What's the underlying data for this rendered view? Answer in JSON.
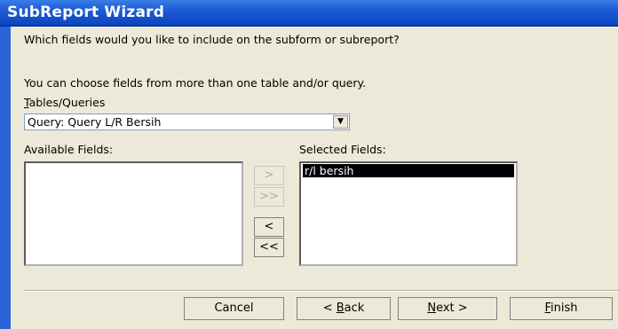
{
  "window": {
    "title": "SubReport Wizard"
  },
  "prompt": {
    "question": "Which fields would you like to include on the subform or subreport?",
    "hint": "You can choose fields from more than one table and/or query."
  },
  "tables_queries": {
    "label_accel": "T",
    "label_rest": "ables/Queries",
    "selected": "Query: Query L/R Bersih",
    "dropdown_icon": "chevron-down-icon"
  },
  "available_fields": {
    "label": "Available Fields:",
    "items": []
  },
  "selected_fields": {
    "label": "Selected Fields:",
    "items": [
      "r/l bersih"
    ]
  },
  "move_buttons": {
    "add_one": ">",
    "add_all": ">>",
    "remove_one": "<",
    "remove_all": "<<"
  },
  "buttons": {
    "cancel": "Cancel",
    "back_pre": "< ",
    "back_accel": "B",
    "back_rest": "ack",
    "next_accel": "N",
    "next_rest": "ext >",
    "finish_accel": "F",
    "finish_rest": "inish"
  },
  "colors": {
    "title_bar": "#1e5bd3",
    "dialog_bg": "#ece9d8",
    "selection": "#000000"
  }
}
